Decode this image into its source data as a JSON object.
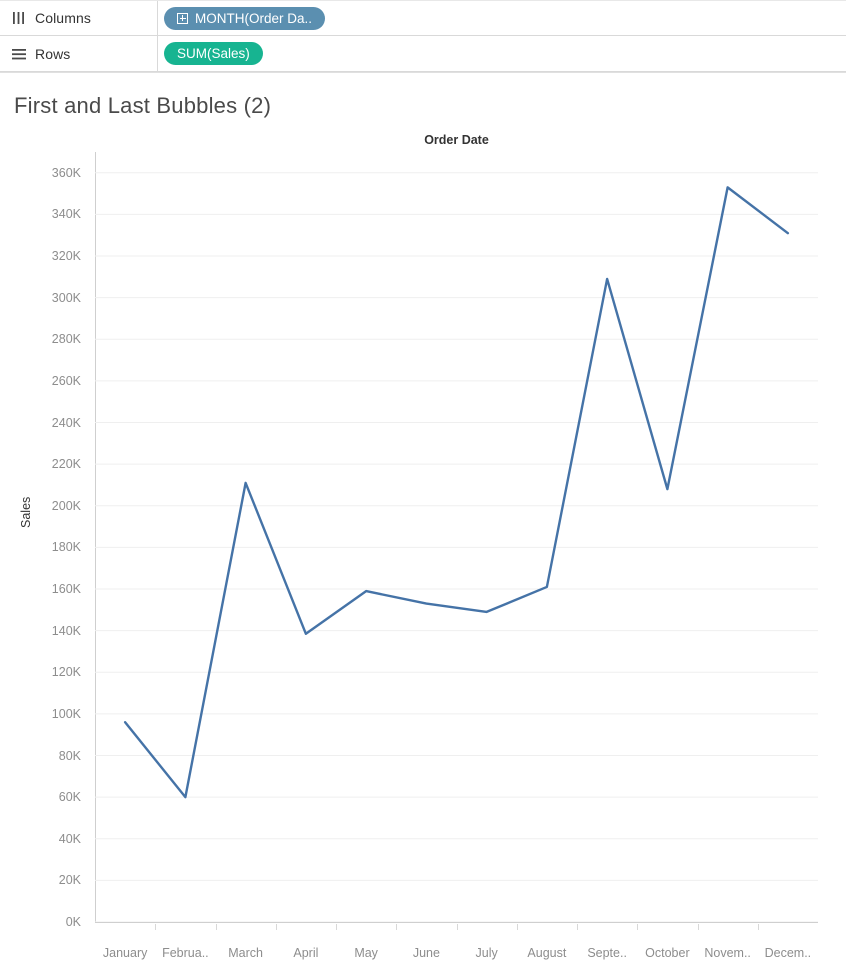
{
  "shelves": [
    {
      "name": "columns",
      "label": "Columns",
      "icon": "columns-icon",
      "pill": {
        "text": "MONTH(Order Da..",
        "type": "dimension",
        "color": "#5b8fb0",
        "has_expand": true
      }
    },
    {
      "name": "rows",
      "label": "Rows",
      "icon": "rows-icon",
      "pill": {
        "text": "SUM(Sales)",
        "type": "measure",
        "color": "#17b491",
        "has_expand": false
      }
    }
  ],
  "worksheet": {
    "title": "First and Last Bubbles (2)",
    "column_header": "Order Date",
    "row_axis_title": "Sales"
  },
  "chart_data": {
    "type": "line",
    "title": "First and Last Bubbles (2)",
    "xlabel": "Order Date",
    "ylabel": "Sales",
    "categories": [
      "January",
      "Februa..",
      "March",
      "April",
      "May",
      "June",
      "July",
      "August",
      "Septe..",
      "October",
      "Novem..",
      "Decem.."
    ],
    "categories_full": [
      "January",
      "February",
      "March",
      "April",
      "May",
      "June",
      "July",
      "August",
      "September",
      "October",
      "November",
      "December"
    ],
    "values": [
      96000,
      60000,
      211000,
      138500,
      159000,
      153000,
      149000,
      161000,
      309000,
      208000,
      353000,
      331000
    ],
    "value_labels": [
      "96K",
      "60K",
      "211K",
      "138.5K",
      "159K",
      "153K",
      "149K",
      "161K",
      "309K",
      "208K",
      "353K",
      "331K"
    ],
    "ylim": [
      0,
      370000
    ],
    "yticks": [
      0,
      20000,
      40000,
      60000,
      80000,
      100000,
      120000,
      140000,
      160000,
      180000,
      200000,
      220000,
      240000,
      260000,
      280000,
      300000,
      320000,
      340000,
      360000
    ],
    "ytick_labels": [
      "0K",
      "20K",
      "40K",
      "60K",
      "80K",
      "100K",
      "120K",
      "140K",
      "160K",
      "180K",
      "200K",
      "220K",
      "240K",
      "260K",
      "280K",
      "300K",
      "320K",
      "340K",
      "360K"
    ],
    "grid": true,
    "legend": "none",
    "line_color": "#4573a7",
    "line_width": 2.4,
    "grid_color": "#efefef",
    "axis_color": "#cfcfcf"
  }
}
